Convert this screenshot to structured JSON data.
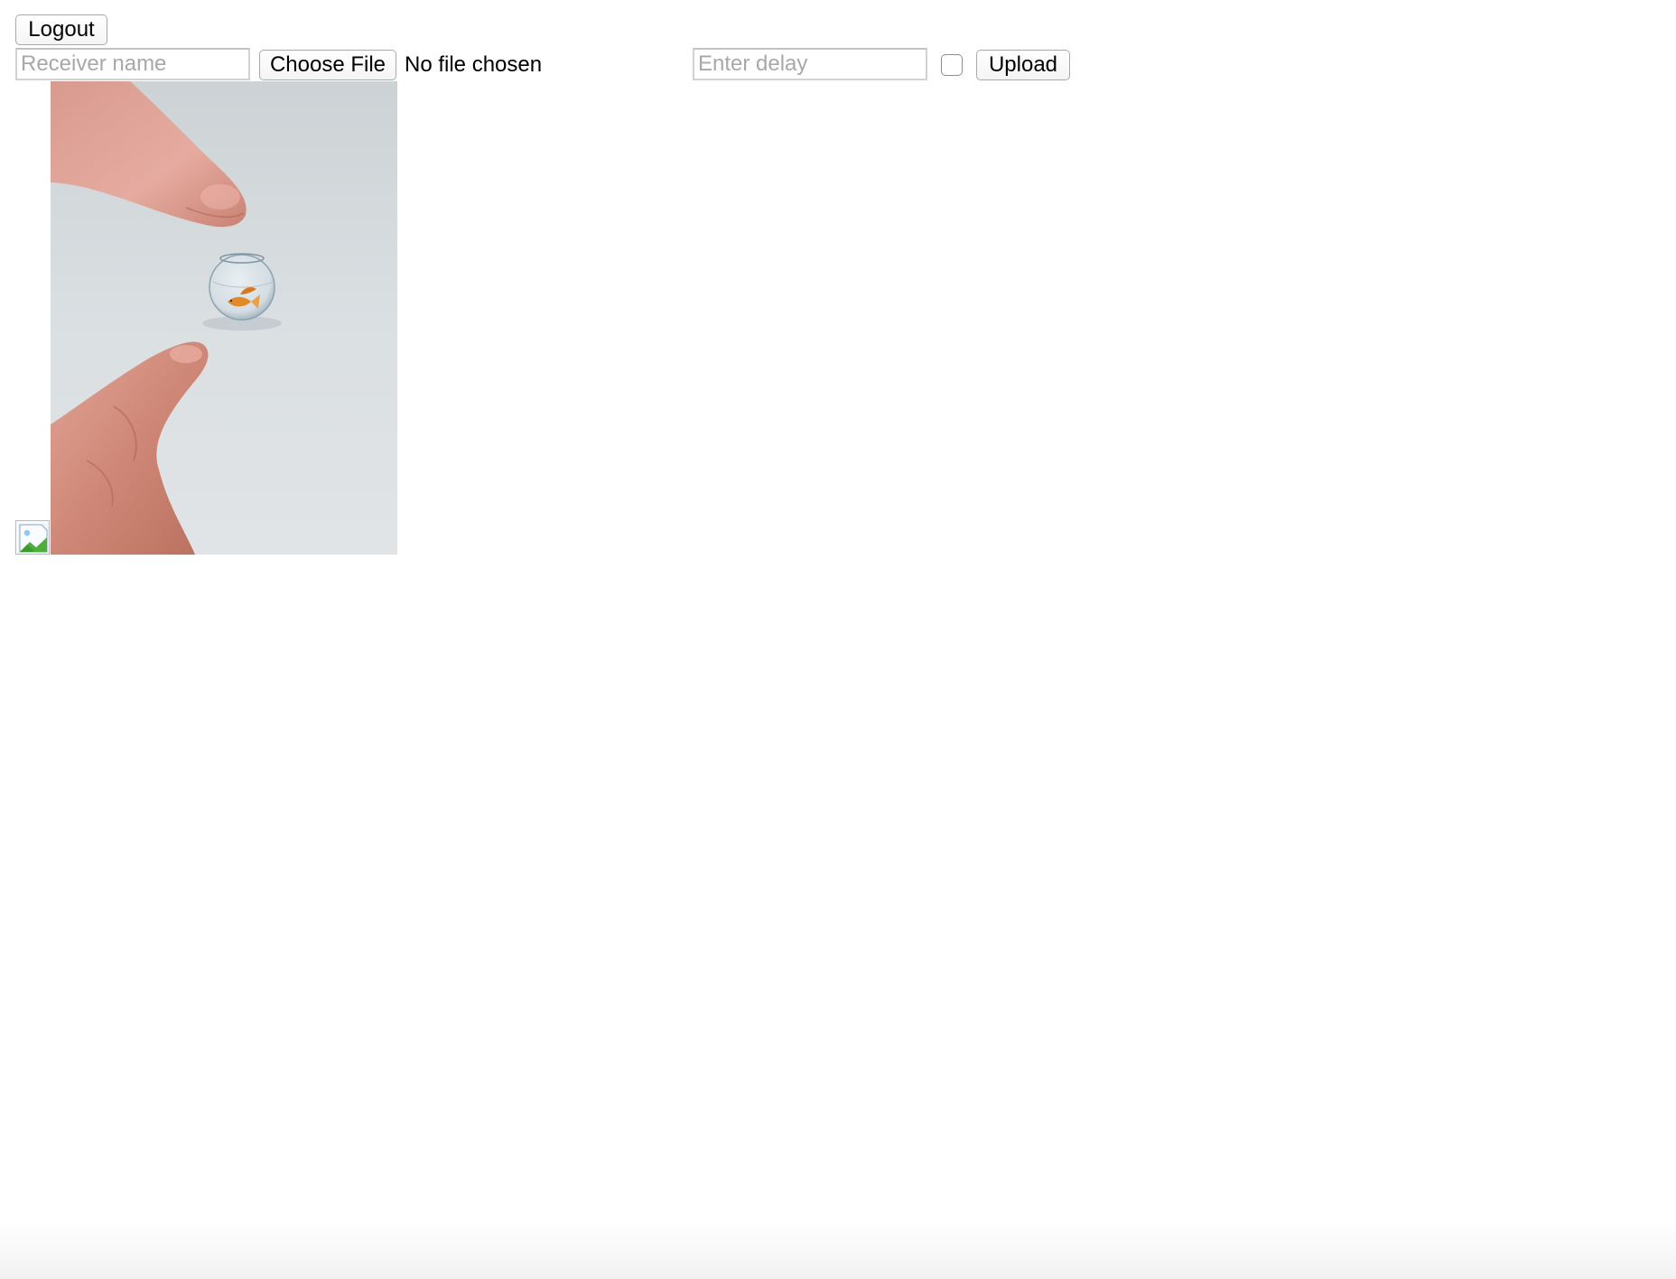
{
  "header": {
    "logout_label": "Logout"
  },
  "upload_form": {
    "receiver_placeholder": "Receiver name",
    "choose_file_label": "Choose File",
    "file_status": "No file chosen",
    "delay_placeholder": "Enter delay",
    "checkbox_checked": false,
    "upload_label": "Upload"
  },
  "images": {
    "broken_image_icon": "broken-image-icon",
    "photo_icon": "fishbowl-between-fingers-photo"
  }
}
